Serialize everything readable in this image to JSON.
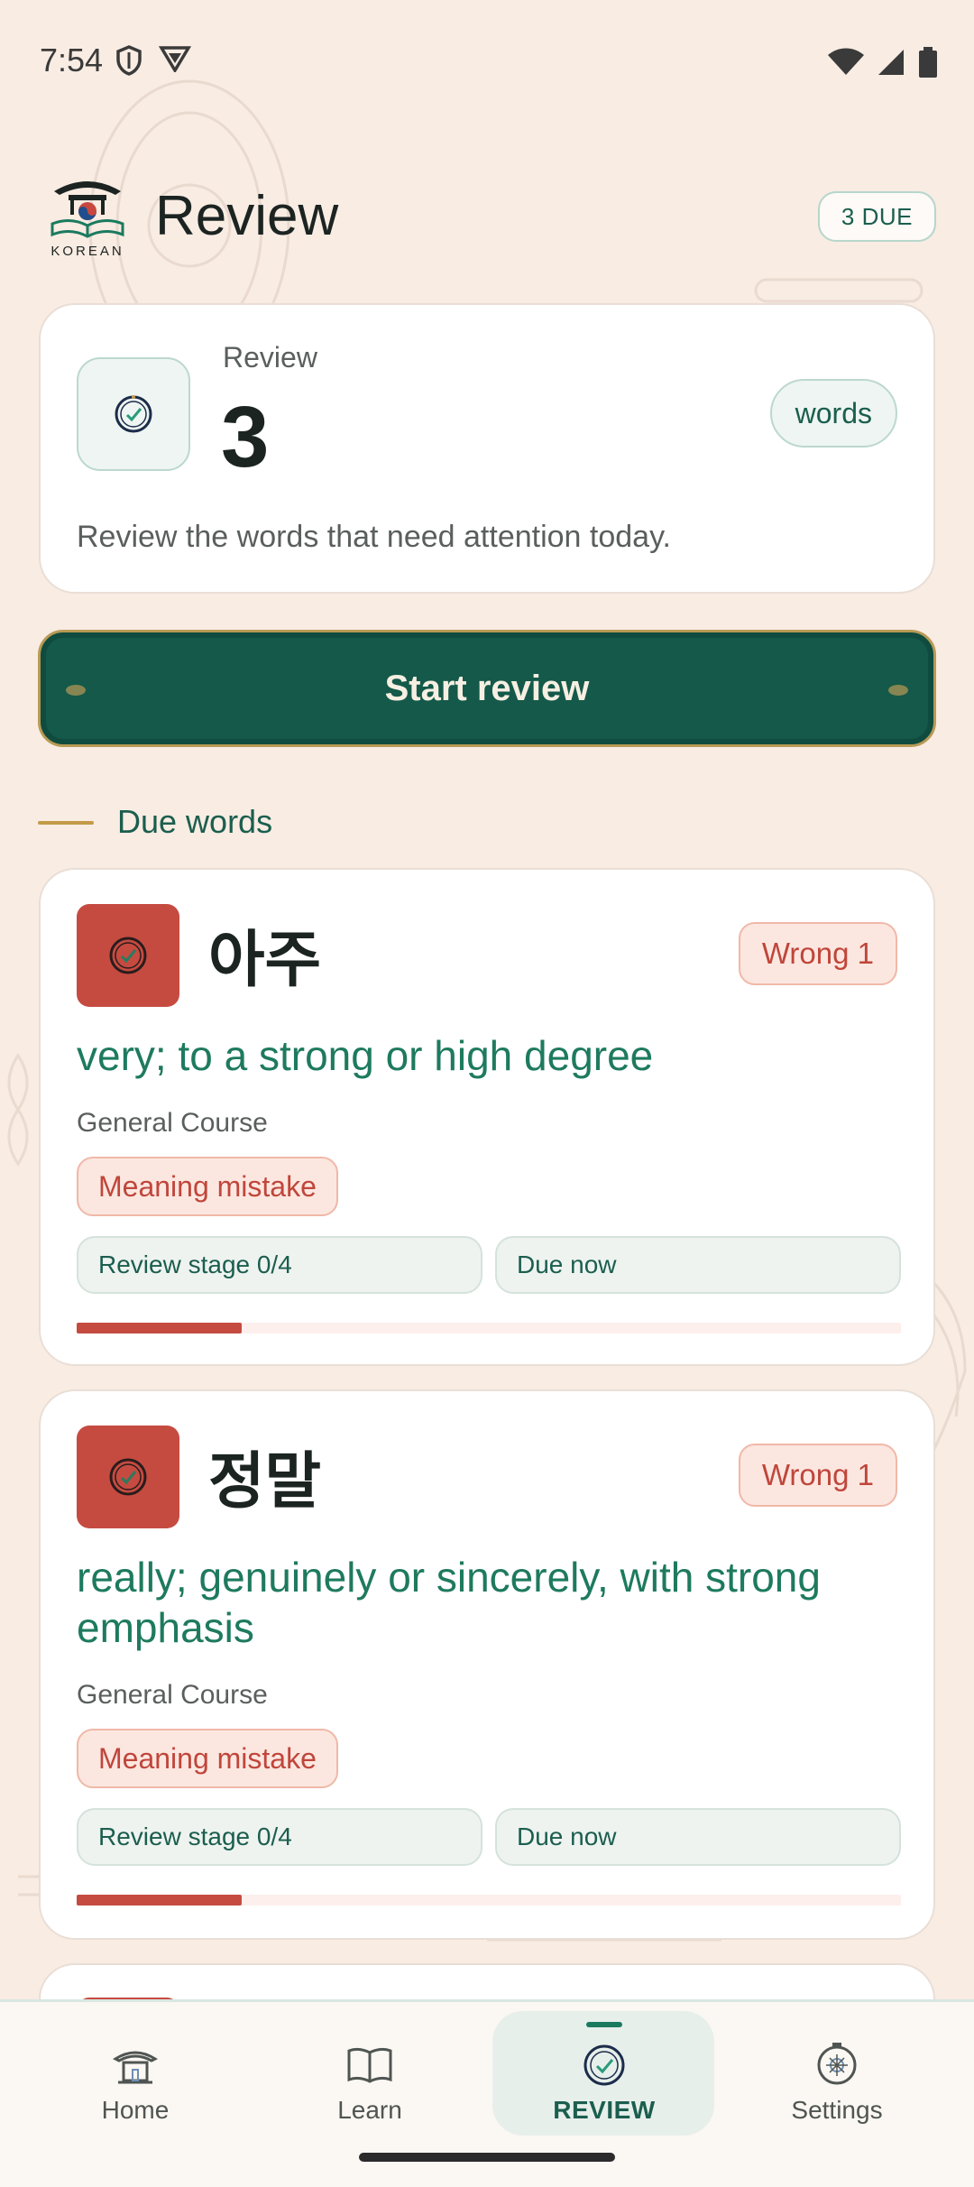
{
  "status_bar": {
    "time": "7:54"
  },
  "header": {
    "logo_text": "KOREAN",
    "title": "Review",
    "due_badge": "3 DUE"
  },
  "summary": {
    "label": "Review",
    "count": "3",
    "unit_chip": "words",
    "description": "Review the words that need attention today."
  },
  "start_button": {
    "label": "Start review"
  },
  "section": {
    "title": "Due words"
  },
  "words": [
    {
      "korean": "아주",
      "wrong": "Wrong 1",
      "meaning": "very; to a strong or high degree",
      "course": "General Course",
      "mistake": "Meaning mistake",
      "stage": "Review stage 0/4",
      "due": "Due now",
      "progress": 0.2
    },
    {
      "korean": "정말",
      "wrong": "Wrong 1",
      "meaning": "really; genuinely or sincerely, with strong emphasis",
      "course": "General Course",
      "mistake": "Meaning mistake",
      "stage": "Review stage 0/4",
      "due": "Due now",
      "progress": 0.2
    }
  ],
  "nav": {
    "home": "Home",
    "learn": "Learn",
    "review": "REVIEW",
    "settings": "Settings"
  },
  "colors": {
    "accent_green": "#14594a",
    "wrong_red": "#c54b41",
    "background": "#f8ece3"
  }
}
